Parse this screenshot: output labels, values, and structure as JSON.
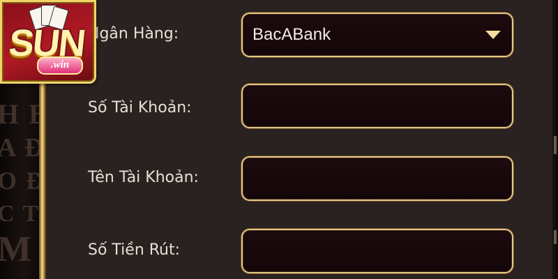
{
  "logo": {
    "brand": "SUN",
    "suffix": ".win"
  },
  "background": {
    "ghost_text": [
      "H B",
      "A Đ",
      "O Đ",
      "C TI",
      "M"
    ]
  },
  "form": {
    "bank": {
      "label": "Ngân Hàng:",
      "value": "BacABank"
    },
    "account_number": {
      "label": "Số Tài Khoản:",
      "value": ""
    },
    "account_name": {
      "label": "Tên Tài Khoản:",
      "value": ""
    },
    "withdraw_amount": {
      "label": "Số Tiền Rút:",
      "value": ""
    }
  },
  "colors": {
    "accent_gold": "#e4c98c",
    "field_bg": "#1c0b0f",
    "panel_bg": "#2a2220"
  }
}
